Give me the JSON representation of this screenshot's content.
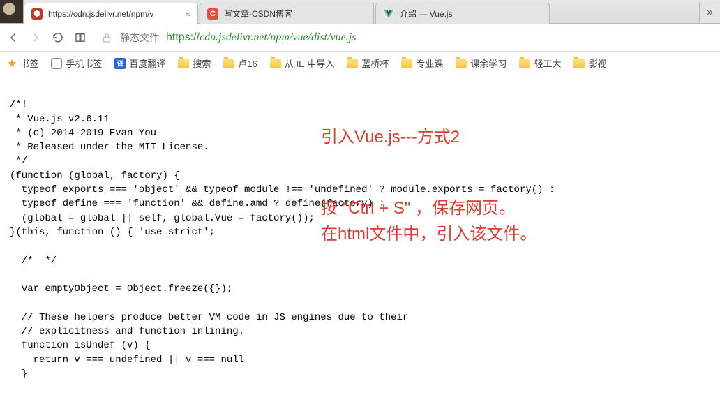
{
  "tabs": {
    "t0": {
      "title": "https://cdn.jsdelivr.net/npm/v"
    },
    "t1": {
      "title": "写文章-CSDN博客"
    },
    "t2": {
      "title": "介绍 — Vue.js"
    }
  },
  "addr": {
    "static_label": "静态文件",
    "host": "https://",
    "path": "cdn.jsdelivr.net/npm/vue/dist/vue.js"
  },
  "bookmarks": {
    "root": "书签",
    "phone": "手机书签",
    "baidu": "百度翻译",
    "b0": "搜索",
    "b1": "卢16",
    "b2": "从 IE 中导入",
    "b3": "蓝桥杯",
    "b4": "专业课",
    "b5": "课余学习",
    "b6": "轻工大",
    "b7": "影视"
  },
  "code": "/*!\n * Vue.js v2.6.11\n * (c) 2014-2019 Evan You\n * Released under the MIT License.\n */\n(function (global, factory) {\n  typeof exports === 'object' && typeof module !== 'undefined' ? module.exports = factory() :\n  typeof define === 'function' && define.amd ? define(factory) :\n  (global = global || self, global.Vue = factory());\n}(this, function () { 'use strict';\n\n  /*  */\n\n  var emptyObject = Object.freeze({});\n\n  // These helpers produce better VM code in JS engines due to their\n  // explicitness and function inlining.\n  function isUndef (v) {\n    return v === undefined || v === null\n  }",
  "annotations": {
    "title": "引入Vue.js---方式2",
    "body": "按 \"Ctrl + S\" ，保存网页。\n在html文件中，引入该文件。"
  }
}
